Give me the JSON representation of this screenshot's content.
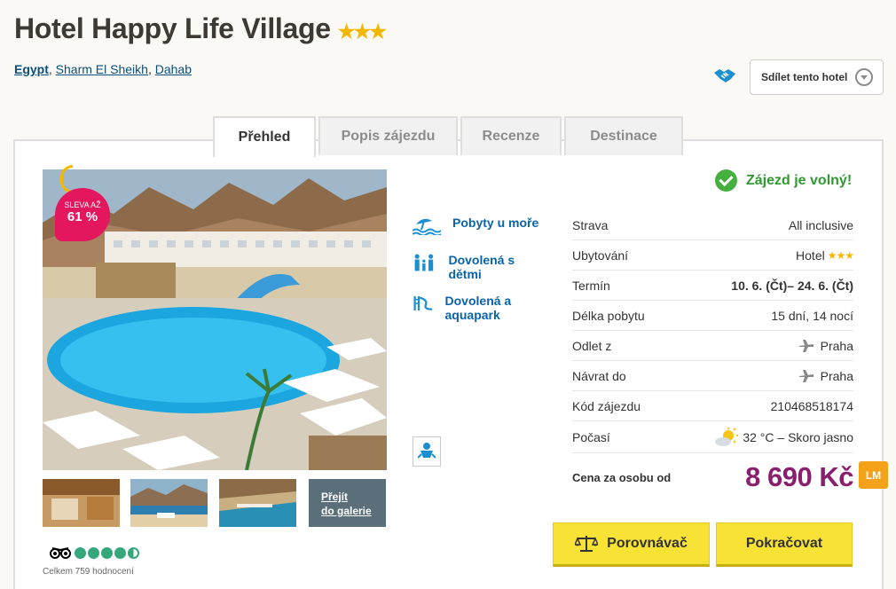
{
  "hotel": {
    "name": "Hotel Happy Life Village",
    "stars": "★★★"
  },
  "breadcrumb": [
    "Egypt",
    "Sharm El Sheikh",
    "Dahab"
  ],
  "share": {
    "label": "Sdílet tento hotel",
    "icon": "handshake-icon"
  },
  "tabs": [
    "Přehled",
    "Popis zájezdu",
    "Recenze",
    "Destinace"
  ],
  "active_tab": 0,
  "badge": {
    "line1": "SLEVA AŽ",
    "line2": "61 %"
  },
  "gallery": {
    "link": [
      "Přejít",
      "do galerie"
    ]
  },
  "rating": {
    "score": 4.5,
    "max": 5,
    "count_text": "Celkem 759 hodnocení"
  },
  "features": [
    {
      "icon": "beach-icon",
      "label": "Pobyty u moře"
    },
    {
      "icon": "family-icon",
      "label": "Dovolená s dětmi"
    },
    {
      "icon": "waterslide-icon",
      "label": "Dovolená a aquapark"
    }
  ],
  "status": "Zájezd je volný!",
  "details": [
    {
      "key": "Strava",
      "value": "All inclusive"
    },
    {
      "key": "Ubytování",
      "value": "Hotel",
      "stars": "★★★"
    },
    {
      "key": "Termín",
      "value": "10. 6. (Čt)– 24. 6. (Čt)",
      "bold": true
    },
    {
      "key": "Délka pobytu",
      "value": "15 dní, 14 nocí"
    },
    {
      "key": "Odlet z",
      "value": "Praha",
      "icon": "plane-icon"
    },
    {
      "key": "Návrat do",
      "value": "Praha",
      "icon": "plane-icon"
    },
    {
      "key": "Kód zájezdu",
      "value": "210468518174"
    },
    {
      "key": "Počasí",
      "value": "32 °C – Skoro jasno",
      "icon": "weather-icon"
    }
  ],
  "price": {
    "label": "Cena za osobu od",
    "value": "8 690 Kč",
    "badge": "LM"
  },
  "buttons": {
    "compare": "Porovnávač",
    "continue": "Pokračovat"
  },
  "colors": {
    "accent": "#f8e235",
    "price": "#8a1f6e",
    "link": "#0a63a8",
    "ok": "#2f9a2f"
  }
}
